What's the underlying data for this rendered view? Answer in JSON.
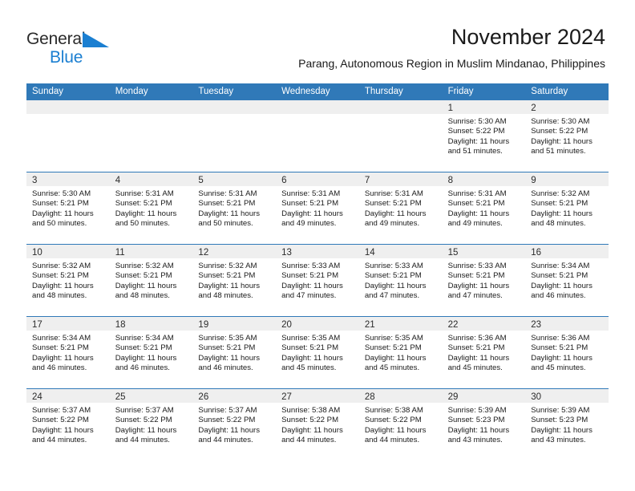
{
  "brand": {
    "name_top": "General",
    "name_bottom": "Blue",
    "triangle_color": "#1b7fd1",
    "top_color": "#2b2b2b",
    "bottom_color": "#1b7fd1"
  },
  "header": {
    "title": "November 2024",
    "subtitle": "Parang, Autonomous Region in Muslim Mindanao, Philippines"
  },
  "colors": {
    "header_bar": "#3079b8",
    "daynum_band": "#efefef",
    "row_rule": "#3079b8",
    "text": "#1a1a1a"
  },
  "weekdays": [
    "Sunday",
    "Monday",
    "Tuesday",
    "Wednesday",
    "Thursday",
    "Friday",
    "Saturday"
  ],
  "weeks": [
    [
      {
        "day": "",
        "empty": true
      },
      {
        "day": "",
        "empty": true
      },
      {
        "day": "",
        "empty": true
      },
      {
        "day": "",
        "empty": true
      },
      {
        "day": "",
        "empty": true
      },
      {
        "day": "1",
        "sunrise": "Sunrise: 5:30 AM",
        "sunset": "Sunset: 5:22 PM",
        "daylight_1": "Daylight: 11 hours",
        "daylight_2": "and 51 minutes."
      },
      {
        "day": "2",
        "sunrise": "Sunrise: 5:30 AM",
        "sunset": "Sunset: 5:22 PM",
        "daylight_1": "Daylight: 11 hours",
        "daylight_2": "and 51 minutes."
      }
    ],
    [
      {
        "day": "3",
        "sunrise": "Sunrise: 5:30 AM",
        "sunset": "Sunset: 5:21 PM",
        "daylight_1": "Daylight: 11 hours",
        "daylight_2": "and 50 minutes."
      },
      {
        "day": "4",
        "sunrise": "Sunrise: 5:31 AM",
        "sunset": "Sunset: 5:21 PM",
        "daylight_1": "Daylight: 11 hours",
        "daylight_2": "and 50 minutes."
      },
      {
        "day": "5",
        "sunrise": "Sunrise: 5:31 AM",
        "sunset": "Sunset: 5:21 PM",
        "daylight_1": "Daylight: 11 hours",
        "daylight_2": "and 50 minutes."
      },
      {
        "day": "6",
        "sunrise": "Sunrise: 5:31 AM",
        "sunset": "Sunset: 5:21 PM",
        "daylight_1": "Daylight: 11 hours",
        "daylight_2": "and 49 minutes."
      },
      {
        "day": "7",
        "sunrise": "Sunrise: 5:31 AM",
        "sunset": "Sunset: 5:21 PM",
        "daylight_1": "Daylight: 11 hours",
        "daylight_2": "and 49 minutes."
      },
      {
        "day": "8",
        "sunrise": "Sunrise: 5:31 AM",
        "sunset": "Sunset: 5:21 PM",
        "daylight_1": "Daylight: 11 hours",
        "daylight_2": "and 49 minutes."
      },
      {
        "day": "9",
        "sunrise": "Sunrise: 5:32 AM",
        "sunset": "Sunset: 5:21 PM",
        "daylight_1": "Daylight: 11 hours",
        "daylight_2": "and 48 minutes."
      }
    ],
    [
      {
        "day": "10",
        "sunrise": "Sunrise: 5:32 AM",
        "sunset": "Sunset: 5:21 PM",
        "daylight_1": "Daylight: 11 hours",
        "daylight_2": "and 48 minutes."
      },
      {
        "day": "11",
        "sunrise": "Sunrise: 5:32 AM",
        "sunset": "Sunset: 5:21 PM",
        "daylight_1": "Daylight: 11 hours",
        "daylight_2": "and 48 minutes."
      },
      {
        "day": "12",
        "sunrise": "Sunrise: 5:32 AM",
        "sunset": "Sunset: 5:21 PM",
        "daylight_1": "Daylight: 11 hours",
        "daylight_2": "and 48 minutes."
      },
      {
        "day": "13",
        "sunrise": "Sunrise: 5:33 AM",
        "sunset": "Sunset: 5:21 PM",
        "daylight_1": "Daylight: 11 hours",
        "daylight_2": "and 47 minutes."
      },
      {
        "day": "14",
        "sunrise": "Sunrise: 5:33 AM",
        "sunset": "Sunset: 5:21 PM",
        "daylight_1": "Daylight: 11 hours",
        "daylight_2": "and 47 minutes."
      },
      {
        "day": "15",
        "sunrise": "Sunrise: 5:33 AM",
        "sunset": "Sunset: 5:21 PM",
        "daylight_1": "Daylight: 11 hours",
        "daylight_2": "and 47 minutes."
      },
      {
        "day": "16",
        "sunrise": "Sunrise: 5:34 AM",
        "sunset": "Sunset: 5:21 PM",
        "daylight_1": "Daylight: 11 hours",
        "daylight_2": "and 46 minutes."
      }
    ],
    [
      {
        "day": "17",
        "sunrise": "Sunrise: 5:34 AM",
        "sunset": "Sunset: 5:21 PM",
        "daylight_1": "Daylight: 11 hours",
        "daylight_2": "and 46 minutes."
      },
      {
        "day": "18",
        "sunrise": "Sunrise: 5:34 AM",
        "sunset": "Sunset: 5:21 PM",
        "daylight_1": "Daylight: 11 hours",
        "daylight_2": "and 46 minutes."
      },
      {
        "day": "19",
        "sunrise": "Sunrise: 5:35 AM",
        "sunset": "Sunset: 5:21 PM",
        "daylight_1": "Daylight: 11 hours",
        "daylight_2": "and 46 minutes."
      },
      {
        "day": "20",
        "sunrise": "Sunrise: 5:35 AM",
        "sunset": "Sunset: 5:21 PM",
        "daylight_1": "Daylight: 11 hours",
        "daylight_2": "and 45 minutes."
      },
      {
        "day": "21",
        "sunrise": "Sunrise: 5:35 AM",
        "sunset": "Sunset: 5:21 PM",
        "daylight_1": "Daylight: 11 hours",
        "daylight_2": "and 45 minutes."
      },
      {
        "day": "22",
        "sunrise": "Sunrise: 5:36 AM",
        "sunset": "Sunset: 5:21 PM",
        "daylight_1": "Daylight: 11 hours",
        "daylight_2": "and 45 minutes."
      },
      {
        "day": "23",
        "sunrise": "Sunrise: 5:36 AM",
        "sunset": "Sunset: 5:21 PM",
        "daylight_1": "Daylight: 11 hours",
        "daylight_2": "and 45 minutes."
      }
    ],
    [
      {
        "day": "24",
        "sunrise": "Sunrise: 5:37 AM",
        "sunset": "Sunset: 5:22 PM",
        "daylight_1": "Daylight: 11 hours",
        "daylight_2": "and 44 minutes."
      },
      {
        "day": "25",
        "sunrise": "Sunrise: 5:37 AM",
        "sunset": "Sunset: 5:22 PM",
        "daylight_1": "Daylight: 11 hours",
        "daylight_2": "and 44 minutes."
      },
      {
        "day": "26",
        "sunrise": "Sunrise: 5:37 AM",
        "sunset": "Sunset: 5:22 PM",
        "daylight_1": "Daylight: 11 hours",
        "daylight_2": "and 44 minutes."
      },
      {
        "day": "27",
        "sunrise": "Sunrise: 5:38 AM",
        "sunset": "Sunset: 5:22 PM",
        "daylight_1": "Daylight: 11 hours",
        "daylight_2": "and 44 minutes."
      },
      {
        "day": "28",
        "sunrise": "Sunrise: 5:38 AM",
        "sunset": "Sunset: 5:22 PM",
        "daylight_1": "Daylight: 11 hours",
        "daylight_2": "and 44 minutes."
      },
      {
        "day": "29",
        "sunrise": "Sunrise: 5:39 AM",
        "sunset": "Sunset: 5:23 PM",
        "daylight_1": "Daylight: 11 hours",
        "daylight_2": "and 43 minutes."
      },
      {
        "day": "30",
        "sunrise": "Sunrise: 5:39 AM",
        "sunset": "Sunset: 5:23 PM",
        "daylight_1": "Daylight: 11 hours",
        "daylight_2": "and 43 minutes."
      }
    ]
  ]
}
